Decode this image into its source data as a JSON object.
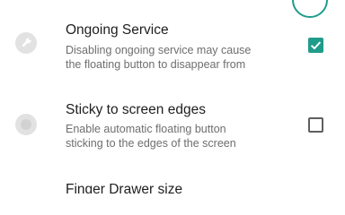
{
  "colors": {
    "accent": "#1f9c8a",
    "title_text": "#1e1e1e",
    "summary_text": "#6e6e6e",
    "icon_bg": "#e2e2e2"
  },
  "settings": {
    "ongoing_service": {
      "title": "Ongoing Service",
      "summary_line1": "Disabling ongoing service may cause",
      "summary_line2": "the floating button to disappear from",
      "checked": true,
      "icon": "wrench-icon"
    },
    "sticky_edges": {
      "title": "Sticky to screen edges",
      "summary_line1": "Enable automatic floating button",
      "summary_line2": "sticking to the edges of the screen",
      "checked": false,
      "icon": "circle-icon"
    },
    "finger_drawer": {
      "title": "Finger Drawer size"
    }
  }
}
